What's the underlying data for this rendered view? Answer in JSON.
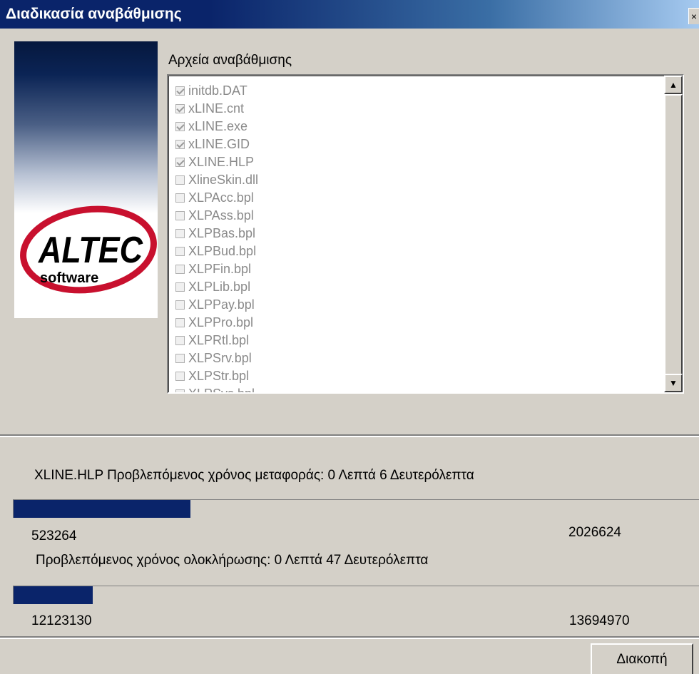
{
  "window": {
    "title": "Διαδικασία αναβάθμισης",
    "close_label": "×"
  },
  "logo": {
    "brand": "ALTEC",
    "tagline": "software"
  },
  "files": {
    "label": "Αρχεία αναβάθμισης",
    "items": [
      {
        "name": "initdb.DAT",
        "checked": true
      },
      {
        "name": "xLINE.cnt",
        "checked": true
      },
      {
        "name": "xLINE.exe",
        "checked": true
      },
      {
        "name": "xLINE.GID",
        "checked": true
      },
      {
        "name": "XLINE.HLP",
        "checked": true
      },
      {
        "name": "XlineSkin.dll",
        "checked": false
      },
      {
        "name": "XLPAcc.bpl",
        "checked": false
      },
      {
        "name": "XLPAss.bpl",
        "checked": false
      },
      {
        "name": "XLPBas.bpl",
        "checked": false
      },
      {
        "name": "XLPBud.bpl",
        "checked": false
      },
      {
        "name": "XLPFin.bpl",
        "checked": false
      },
      {
        "name": "XLPLib.bpl",
        "checked": false
      },
      {
        "name": "XLPPay.bpl",
        "checked": false
      },
      {
        "name": "XLPPro.bpl",
        "checked": false
      },
      {
        "name": "XLPRtl.bpl",
        "checked": false
      },
      {
        "name": "XLPSrv.bpl",
        "checked": false
      },
      {
        "name": "XLPStr.bpl",
        "checked": false
      },
      {
        "name": "XLPSys.bpl",
        "checked": false
      }
    ]
  },
  "file_transfer": {
    "status": "XLINE.HLP Προβλεπόμενος χρόνος μεταφοράς:   0 Λεπτά 6 Δευτερόλεπτα",
    "current": "523264",
    "total": "2026624",
    "progress": 0.258
  },
  "overall": {
    "status": "Προβλεπόμενος χρόνος ολοκλήρωσης:   0 Λεπτά 47 Δευτερόλεπτα",
    "current": "12123130",
    "total": "13694970",
    "progress": 0.115
  },
  "cancel_label": "Διακοπή",
  "colors": {
    "title_bar": "#0a246a",
    "progress_fill": "#0a246a",
    "logo_red": "#c8102e",
    "dialog_bg": "#d4d0c8"
  }
}
